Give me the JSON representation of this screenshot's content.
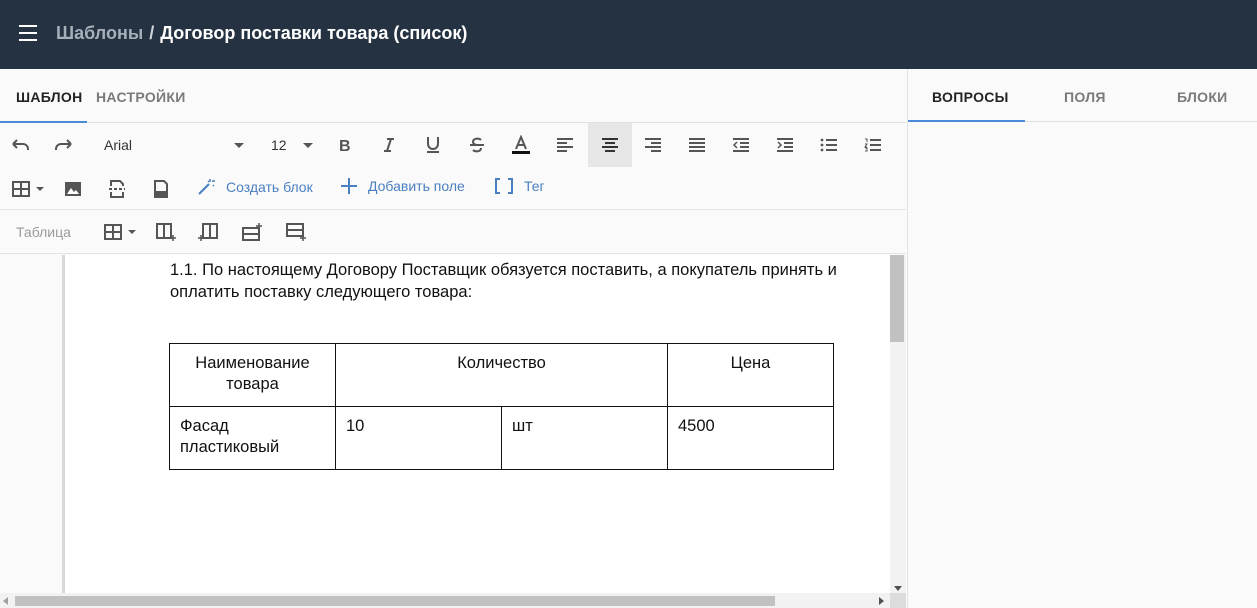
{
  "header": {
    "breadcrumb_parent": "Шаблоны",
    "breadcrumb_separator": "/",
    "title": "Договор поставки товара (список)"
  },
  "editor_tabs": [
    {
      "label": "ШАБЛОН",
      "active": true
    },
    {
      "label": "НАСТРОЙКИ",
      "active": false
    }
  ],
  "side_tabs": [
    {
      "label": "ВОПРОСЫ",
      "active": true
    },
    {
      "label": "ПОЛЯ",
      "active": false
    },
    {
      "label": "БЛОКИ",
      "active": false
    }
  ],
  "toolbar": {
    "font_family": "Arial",
    "font_size": "12",
    "create_block_label": "Создать блок",
    "add_field_label": "Добавить поле",
    "tag_label": "Тег",
    "table_section_label": "Таблица",
    "active_alignment": "center"
  },
  "document": {
    "paragraph": "1.1. По настоящему Договору Поставщик обязуется поставить, а покупатель принять и оплатить поставку следующего товара:",
    "table": {
      "headers": [
        "Наименование товара",
        "Количество",
        "Цена"
      ],
      "rows": [
        [
          "Фасад пластиковый",
          "10",
          "шт",
          "4500"
        ]
      ]
    }
  },
  "colors": {
    "header_bg": "#243242",
    "accent": "#4a8bdc",
    "link": "#4a7fc0"
  }
}
